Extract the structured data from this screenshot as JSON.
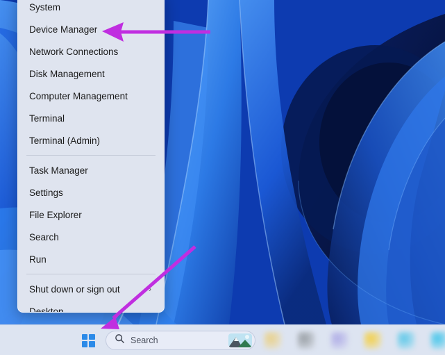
{
  "desktop": {
    "wallpaper_name": "windows-11-bloom-wallpaper",
    "wallpaper_colors": [
      "#1452d8",
      "#2f7bf0",
      "#0b1c5e",
      "#061233",
      "#4ea0ff"
    ]
  },
  "context_menu": {
    "name": "power-user-menu",
    "background": "#dfe4ef",
    "items": [
      {
        "label": "System",
        "submenu": false,
        "separator_after": false
      },
      {
        "label": "Device Manager",
        "submenu": false,
        "separator_after": false
      },
      {
        "label": "Network Connections",
        "submenu": false,
        "separator_after": false
      },
      {
        "label": "Disk Management",
        "submenu": false,
        "separator_after": false
      },
      {
        "label": "Computer Management",
        "submenu": false,
        "separator_after": false
      },
      {
        "label": "Terminal",
        "submenu": false,
        "separator_after": false
      },
      {
        "label": "Terminal (Admin)",
        "submenu": false,
        "separator_after": true
      },
      {
        "label": "Task Manager",
        "submenu": false,
        "separator_after": false
      },
      {
        "label": "Settings",
        "submenu": false,
        "separator_after": false
      },
      {
        "label": "File Explorer",
        "submenu": false,
        "separator_after": false
      },
      {
        "label": "Search",
        "submenu": false,
        "separator_after": false
      },
      {
        "label": "Run",
        "submenu": false,
        "separator_after": true
      },
      {
        "label": "Shut down or sign out",
        "submenu": true,
        "chevron": "›",
        "separator_after": false
      },
      {
        "label": "Desktop",
        "submenu": false,
        "separator_after": false
      }
    ]
  },
  "taskbar": {
    "background": "#dde4f1",
    "start_button": {
      "icon": "windows-logo-icon",
      "color": "#2b8ae8"
    },
    "search": {
      "icon": "search-icon",
      "placeholder": "Search",
      "value": "Search",
      "thumbnail": "mountain-landscape-thumbnail"
    },
    "pinned_icons": [
      {
        "name": "taskbar-icon-1",
        "color": "#e8d08a"
      },
      {
        "name": "taskbar-icon-2",
        "color": "#9aa0a6"
      },
      {
        "name": "taskbar-icon-3",
        "color": "#b0aee6"
      },
      {
        "name": "taskbar-icon-4",
        "color": "#f2cf4a"
      },
      {
        "name": "taskbar-icon-5",
        "color": "#5fc8e8"
      },
      {
        "name": "taskbar-icon-6",
        "color": "#49c6ea"
      }
    ]
  },
  "annotations": {
    "color": "#c02ee0",
    "arrows": [
      {
        "name": "arrow-pointing-to-device-manager",
        "points_to": "Device Manager"
      },
      {
        "name": "arrow-pointing-to-start-button",
        "points_to": "Start button"
      }
    ]
  }
}
